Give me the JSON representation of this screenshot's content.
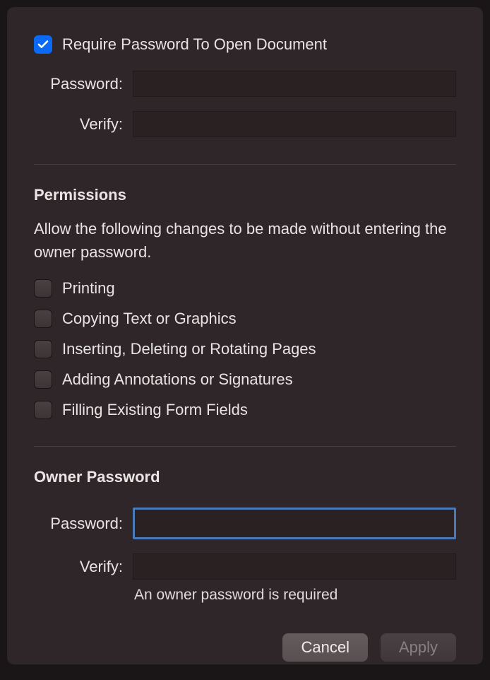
{
  "requirePassword": {
    "label": "Require Password To Open Document",
    "passwordLabel": "Password:",
    "verifyLabel": "Verify:"
  },
  "permissions": {
    "title": "Permissions",
    "description": "Allow the following changes to be made without entering the owner password.",
    "items": [
      {
        "label": "Printing"
      },
      {
        "label": "Copying Text or Graphics"
      },
      {
        "label": "Inserting, Deleting or Rotating Pages"
      },
      {
        "label": "Adding Annotations or Signatures"
      },
      {
        "label": "Filling Existing Form Fields"
      }
    ]
  },
  "ownerPassword": {
    "title": "Owner Password",
    "passwordLabel": "Password:",
    "verifyLabel": "Verify:",
    "hint": "An owner password is required"
  },
  "buttons": {
    "cancel": "Cancel",
    "apply": "Apply"
  }
}
